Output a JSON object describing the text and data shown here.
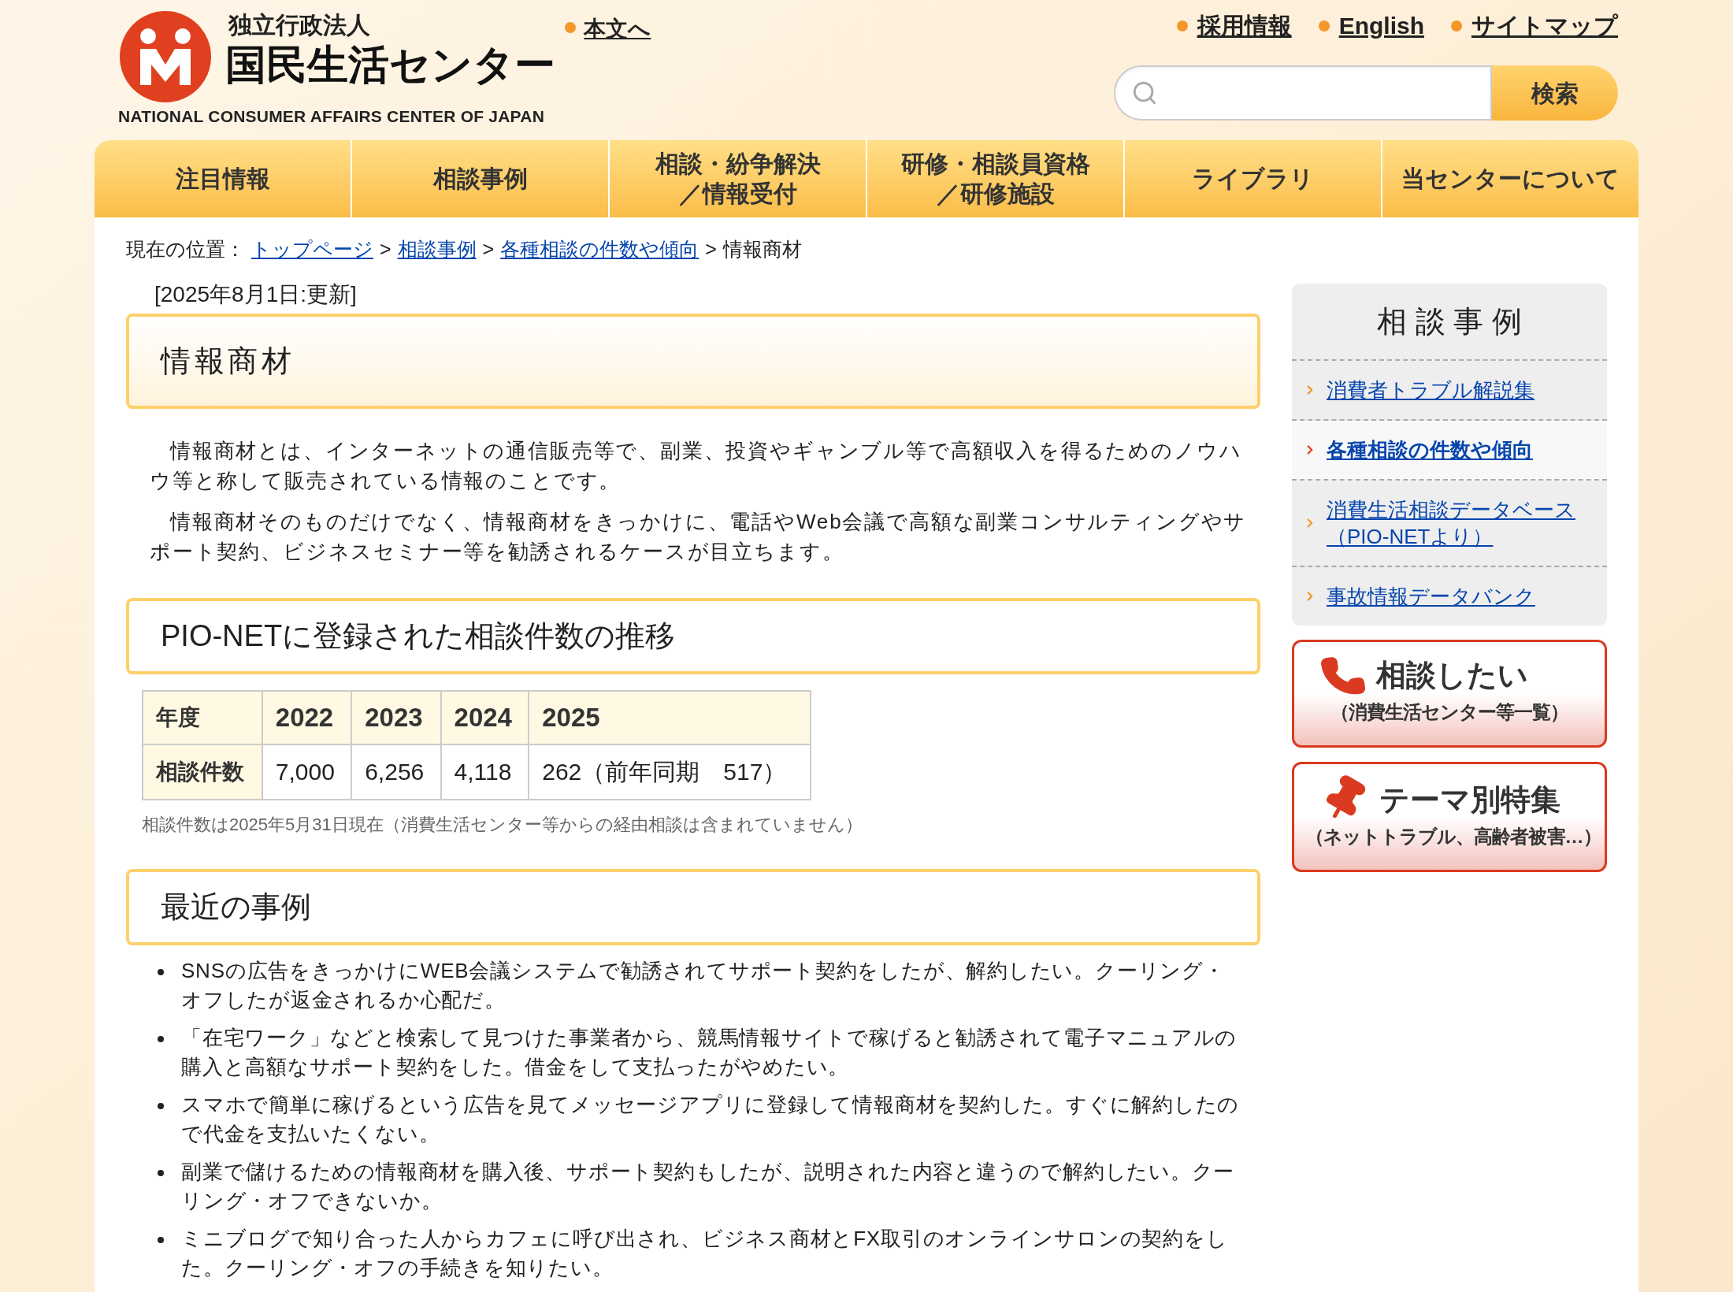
{
  "header": {
    "logo": {
      "org_type": "独立行政法人",
      "name": "国民生活センター",
      "english": "NATIONAL CONSUMER AFFAIRS CENTER OF JAPAN"
    },
    "skip_link": "本文へ",
    "top_links": [
      "採用情報",
      "English",
      "サイトマップ"
    ],
    "search": {
      "button": "検索"
    }
  },
  "nav": [
    {
      "label": "注目情報"
    },
    {
      "label": "相談事例"
    },
    {
      "label": "相談・紛争解決",
      "label_line2": "／情報受付"
    },
    {
      "label": "研修・相談員資格",
      "label_line2": "／研修施設"
    },
    {
      "label": "ライブラリ"
    },
    {
      "label": "当センターについて"
    }
  ],
  "breadcrumb": {
    "label": "現在の位置：",
    "items": [
      {
        "text": "トップページ",
        "kind": "link"
      },
      {
        "text": ">",
        "kind": "separator"
      },
      {
        "text": "相談事例",
        "kind": "link"
      },
      {
        "text": ">",
        "kind": "separator"
      },
      {
        "text": "各種相談の件数や傾向",
        "kind": "link"
      },
      {
        "text": ">",
        "kind": "separator"
      },
      {
        "text": "情報商材",
        "kind": "current"
      }
    ]
  },
  "updated": "[2025年8月1日:更新]",
  "title": "情報商材",
  "intro": [
    "情報商材とは、インターネットの通信販売等で、副業、投資やギャンブル等で高額収入を得るためのノウハウ等と称して販売されている情報のことです。",
    "情報商材そのものだけでなく、情報商材をきっかけに、電話やWeb会議で高額な副業コンサルティングやサポート契約、ビジネスセミナー等を勧誘されるケースが目立ちます。"
  ],
  "trend": {
    "heading": "PIO-NETに登録された相談件数の推移",
    "table": {
      "columns": [
        "年度",
        "2022",
        "2023",
        "2024",
        "2025"
      ],
      "rows": [
        {
          "cells": [
            "相談件数",
            "7,000",
            "6,256",
            "4,118",
            "262（前年同期　517）"
          ]
        }
      ]
    },
    "note": "相談件数は2025年5月31日現在（消費生活センター等からの経由相談は含まれていません）"
  },
  "recent": {
    "heading": "最近の事例",
    "items": [
      "SNSの広告をきっかけにWEB会議システムで勧誘されてサポート契約をしたが、解約したい。クーリング・オフしたが返金されるか心配だ。",
      "「在宅ワーク」などと検索して見つけた事業者から、競馬情報サイトで稼げると勧誘されて電子マニュアルの購入と高額なサポート契約をした。借金をして支払ったがやめたい。",
      "スマホで簡単に稼げるという広告を見てメッセージアプリに登録して情報商材を契約した。すぐに解約したので代金を支払いたくない。",
      "副業で儲けるための情報商材を購入後、サポート契約もしたが、説明された内容と違うので解約したい。クーリング・オフできないか。",
      "ミニブログで知り合った人からカフェに呼び出され、ビジネス商材とFX取引のオンラインサロンの契約をした。クーリング・オフの手続きを知りたい。"
    ]
  },
  "sidebar": {
    "title": "相 談 事 例",
    "items": [
      {
        "text": "消費者トラブル解説集",
        "selected": false
      },
      {
        "text": "各種相談の件数や傾向",
        "selected": true
      },
      {
        "text": "消費生活相談データベース",
        "text_line2": "（PIO-NETより）",
        "selected": false
      },
      {
        "text": "事故情報データバンク",
        "selected": false
      }
    ],
    "banners": [
      {
        "kind": "phone",
        "title": "相談したい",
        "subtitle": "（消費生活センター等一覧）"
      },
      {
        "kind": "pin",
        "title": "テーマ別特集",
        "subtitle": "（ネットトラブル、高齢者被害…）"
      }
    ]
  }
}
